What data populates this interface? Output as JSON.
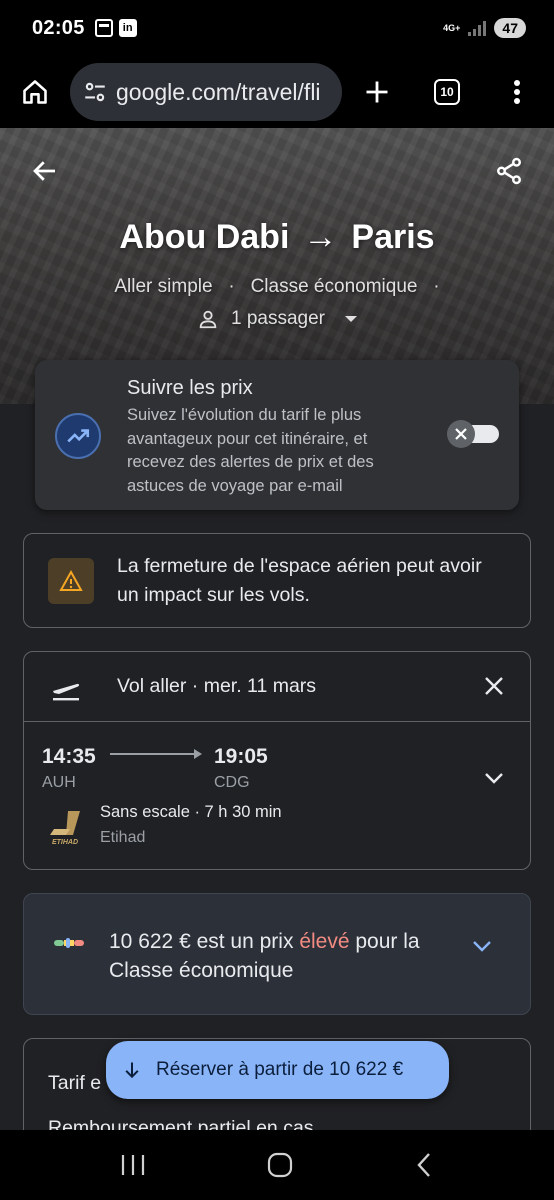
{
  "status_bar": {
    "time": "02:05",
    "network": "4G+",
    "battery": "47"
  },
  "browser": {
    "url": "google.com/travel/fli",
    "tab_count": "10"
  },
  "hero": {
    "origin": "Abou Dabi",
    "arrow": "→",
    "destination": "Paris",
    "trip_type": "Aller simple",
    "cabin_class": "Classe économique",
    "passengers": "1 passager"
  },
  "track_prices": {
    "title": "Suivre les prix",
    "description": "Suivez l'évolution du tarif le plus avantageux pour cet itinéraire, et recevez des alertes de prix et des astuces de voyage par e-mail",
    "enabled": false
  },
  "alert": {
    "text": "La fermeture de l'espace aérien peut avoir un impact sur les vols."
  },
  "flight": {
    "header": "Vol aller · mer. 11 mars",
    "departure_time": "14:35",
    "departure_code": "AUH",
    "arrival_time": "19:05",
    "arrival_code": "CDG",
    "meta": "Sans escale · 7 h 30 min",
    "airline": "Etihad",
    "logo_text": "ETIHAD"
  },
  "price_insight": {
    "price": "10 622 €",
    "pre_text": " est un prix ",
    "level": "élevé",
    "post_text": " pour la Classe économique",
    "high_color": "#f28b82"
  },
  "fare": {
    "title": "Tarif e",
    "description": "Remboursement partiel en cas"
  },
  "fab": {
    "label": "Réserver à partir de 10 622 €"
  },
  "colors": {
    "accent": "#8ab4f8",
    "background": "#202124"
  }
}
